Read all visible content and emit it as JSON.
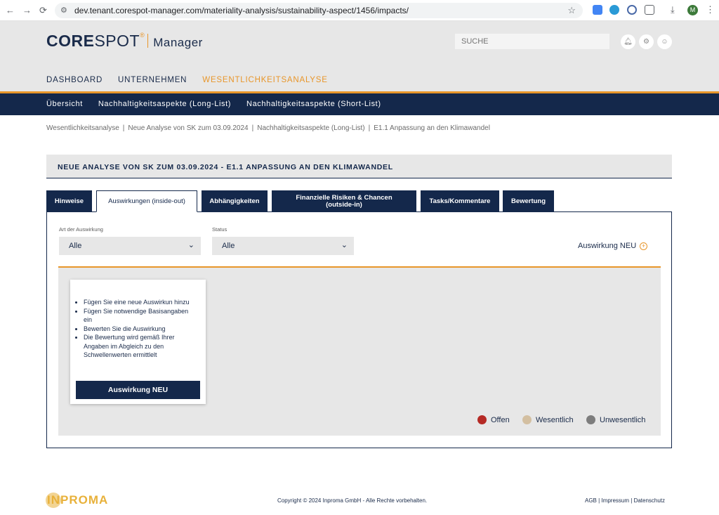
{
  "browser": {
    "back": "←",
    "forward": "→",
    "reload": "⟳",
    "url": "dev.tenant.corespot-manager.com/materiality-analysis/sustainability-aspect/1456/impacts/",
    "profile_initial": "M"
  },
  "header": {
    "logo_core": "CORE",
    "logo_spot": "SPOT",
    "logo_reg": "®",
    "logo_manager": "Manager",
    "search_placeholder": "SUCHE"
  },
  "main_nav": {
    "items": [
      {
        "label": "DASHBOARD",
        "active": false
      },
      {
        "label": "UNTERNEHMEN",
        "active": false
      },
      {
        "label": "WESENTLICHKEITSANALYSE",
        "active": true
      }
    ]
  },
  "sub_nav": {
    "items": [
      {
        "label": "Übersicht"
      },
      {
        "label": "Nachhaltigkeitsaspekte (Long-List)"
      },
      {
        "label": "Nachhaltigkeitsaspekte (Short-List)"
      }
    ]
  },
  "breadcrumb": {
    "items": [
      "Wesentlichkeitsanalyse",
      "Neue Analyse von SK zum 03.09.2024",
      "Nachhaltigkeitsaspekte (Long-List)",
      "E1.1 Anpassung an den Klimawandel"
    ],
    "separator": "|"
  },
  "page": {
    "title": "NEUE ANALYSE VON SK ZUM 03.09.2024 - E1.1 ANPASSUNG AN DEN KLIMAWANDEL"
  },
  "tabs": [
    {
      "label": "Hinweise",
      "active": false
    },
    {
      "label": "Auswirkungen (inside-out)",
      "active": true
    },
    {
      "label": "Abhängigkeiten",
      "active": false
    },
    {
      "label": "Finanzielle Risiken & Chancen",
      "label2": "(outside-in)",
      "active": false
    },
    {
      "label": "Tasks/Kommentare",
      "active": false
    },
    {
      "label": "Bewertung",
      "active": false
    }
  ],
  "filters": {
    "type_label": "Art der Auswirkung",
    "type_value": "Alle",
    "status_label": "Status",
    "status_value": "Alle"
  },
  "new_impact_link": "Auswirkung NEU",
  "empty_card": {
    "bullets": [
      "Fügen Sie eine neue Auswirkun hinzu",
      "Fügen Sie notwendige Basisangaben ein",
      "Bewerten Sie die Auswirkung",
      "Die Bewertung wird gemäß Ihrer Angaben im Abgleich zu den Schwellenwerten ermittlelt"
    ],
    "button": "Auswirkung NEU"
  },
  "legend": [
    {
      "label": "Offen",
      "color": "#b52a25"
    },
    {
      "label": "Wesentlich",
      "color": "#d3bfa1"
    },
    {
      "label": "Unwesentlich",
      "color": "#7d7d7d"
    }
  ],
  "footer": {
    "logo_text": "INPROMA",
    "copyright": "Copyright © 2024 Inproma GmbH - Alle Rechte vorbehalten.",
    "links": [
      "AGB",
      "Impressum",
      "Datenschutz"
    ],
    "links_separator": "|"
  },
  "colors": {
    "navy": "#14284b",
    "accent": "#e8962a",
    "light_gray": "#e7e7e7"
  }
}
